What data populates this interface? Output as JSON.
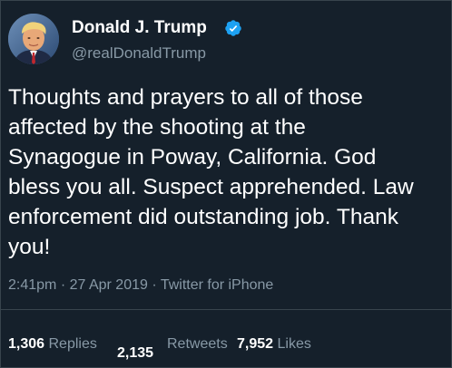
{
  "theme": {
    "background": "#15202b",
    "text": "#ffffff",
    "secondary_text": "#8899a6",
    "divider": "#38444d",
    "verified_badge": "#1da1f2"
  },
  "author": {
    "display_name": "Donald J. Trump",
    "handle": "@realDonaldTrump",
    "avatar_icon": "profile-photo",
    "verified_icon": "verified-badge-icon"
  },
  "tweet": {
    "text": "Thoughts and prayers to all of those\naffected by the shooting at the\nSynagogue in Poway, California. God\nbless you all. Suspect apprehended. Law\nenforcement did outstanding job. Thank\nyou!",
    "meta": "2:41pm · 27 Apr 2019 · Twitter for iPhone"
  },
  "stats": {
    "replies_count": "1,306",
    "replies_label": "Replies",
    "retweets_count": "2,135",
    "retweets_label": "Retweets",
    "likes_count": "7,952",
    "likes_label": "Likes"
  }
}
